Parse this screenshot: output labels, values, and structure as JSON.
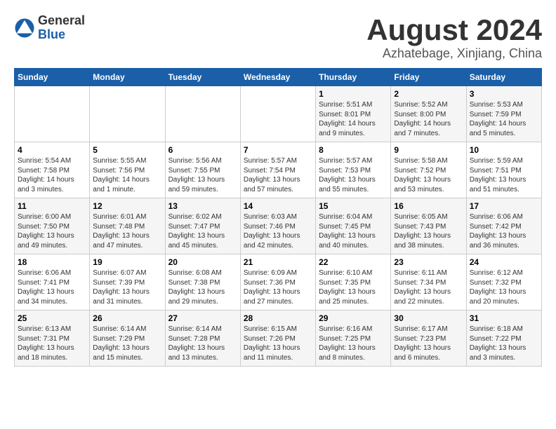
{
  "header": {
    "logo_general": "General",
    "logo_blue": "Blue",
    "month_year": "August 2024",
    "location": "Azhatebage, Xinjiang, China"
  },
  "weekdays": [
    "Sunday",
    "Monday",
    "Tuesday",
    "Wednesday",
    "Thursday",
    "Friday",
    "Saturday"
  ],
  "weeks": [
    [
      {
        "day": "",
        "info": ""
      },
      {
        "day": "",
        "info": ""
      },
      {
        "day": "",
        "info": ""
      },
      {
        "day": "",
        "info": ""
      },
      {
        "day": "1",
        "info": "Sunrise: 5:51 AM\nSunset: 8:01 PM\nDaylight: 14 hours\nand 9 minutes."
      },
      {
        "day": "2",
        "info": "Sunrise: 5:52 AM\nSunset: 8:00 PM\nDaylight: 14 hours\nand 7 minutes."
      },
      {
        "day": "3",
        "info": "Sunrise: 5:53 AM\nSunset: 7:59 PM\nDaylight: 14 hours\nand 5 minutes."
      }
    ],
    [
      {
        "day": "4",
        "info": "Sunrise: 5:54 AM\nSunset: 7:58 PM\nDaylight: 14 hours\nand 3 minutes."
      },
      {
        "day": "5",
        "info": "Sunrise: 5:55 AM\nSunset: 7:56 PM\nDaylight: 14 hours\nand 1 minute."
      },
      {
        "day": "6",
        "info": "Sunrise: 5:56 AM\nSunset: 7:55 PM\nDaylight: 13 hours\nand 59 minutes."
      },
      {
        "day": "7",
        "info": "Sunrise: 5:57 AM\nSunset: 7:54 PM\nDaylight: 13 hours\nand 57 minutes."
      },
      {
        "day": "8",
        "info": "Sunrise: 5:57 AM\nSunset: 7:53 PM\nDaylight: 13 hours\nand 55 minutes."
      },
      {
        "day": "9",
        "info": "Sunrise: 5:58 AM\nSunset: 7:52 PM\nDaylight: 13 hours\nand 53 minutes."
      },
      {
        "day": "10",
        "info": "Sunrise: 5:59 AM\nSunset: 7:51 PM\nDaylight: 13 hours\nand 51 minutes."
      }
    ],
    [
      {
        "day": "11",
        "info": "Sunrise: 6:00 AM\nSunset: 7:50 PM\nDaylight: 13 hours\nand 49 minutes."
      },
      {
        "day": "12",
        "info": "Sunrise: 6:01 AM\nSunset: 7:48 PM\nDaylight: 13 hours\nand 47 minutes."
      },
      {
        "day": "13",
        "info": "Sunrise: 6:02 AM\nSunset: 7:47 PM\nDaylight: 13 hours\nand 45 minutes."
      },
      {
        "day": "14",
        "info": "Sunrise: 6:03 AM\nSunset: 7:46 PM\nDaylight: 13 hours\nand 42 minutes."
      },
      {
        "day": "15",
        "info": "Sunrise: 6:04 AM\nSunset: 7:45 PM\nDaylight: 13 hours\nand 40 minutes."
      },
      {
        "day": "16",
        "info": "Sunrise: 6:05 AM\nSunset: 7:43 PM\nDaylight: 13 hours\nand 38 minutes."
      },
      {
        "day": "17",
        "info": "Sunrise: 6:06 AM\nSunset: 7:42 PM\nDaylight: 13 hours\nand 36 minutes."
      }
    ],
    [
      {
        "day": "18",
        "info": "Sunrise: 6:06 AM\nSunset: 7:41 PM\nDaylight: 13 hours\nand 34 minutes."
      },
      {
        "day": "19",
        "info": "Sunrise: 6:07 AM\nSunset: 7:39 PM\nDaylight: 13 hours\nand 31 minutes."
      },
      {
        "day": "20",
        "info": "Sunrise: 6:08 AM\nSunset: 7:38 PM\nDaylight: 13 hours\nand 29 minutes."
      },
      {
        "day": "21",
        "info": "Sunrise: 6:09 AM\nSunset: 7:36 PM\nDaylight: 13 hours\nand 27 minutes."
      },
      {
        "day": "22",
        "info": "Sunrise: 6:10 AM\nSunset: 7:35 PM\nDaylight: 13 hours\nand 25 minutes."
      },
      {
        "day": "23",
        "info": "Sunrise: 6:11 AM\nSunset: 7:34 PM\nDaylight: 13 hours\nand 22 minutes."
      },
      {
        "day": "24",
        "info": "Sunrise: 6:12 AM\nSunset: 7:32 PM\nDaylight: 13 hours\nand 20 minutes."
      }
    ],
    [
      {
        "day": "25",
        "info": "Sunrise: 6:13 AM\nSunset: 7:31 PM\nDaylight: 13 hours\nand 18 minutes."
      },
      {
        "day": "26",
        "info": "Sunrise: 6:14 AM\nSunset: 7:29 PM\nDaylight: 13 hours\nand 15 minutes."
      },
      {
        "day": "27",
        "info": "Sunrise: 6:14 AM\nSunset: 7:28 PM\nDaylight: 13 hours\nand 13 minutes."
      },
      {
        "day": "28",
        "info": "Sunrise: 6:15 AM\nSunset: 7:26 PM\nDaylight: 13 hours\nand 11 minutes."
      },
      {
        "day": "29",
        "info": "Sunrise: 6:16 AM\nSunset: 7:25 PM\nDaylight: 13 hours\nand 8 minutes."
      },
      {
        "day": "30",
        "info": "Sunrise: 6:17 AM\nSunset: 7:23 PM\nDaylight: 13 hours\nand 6 minutes."
      },
      {
        "day": "31",
        "info": "Sunrise: 6:18 AM\nSunset: 7:22 PM\nDaylight: 13 hours\nand 3 minutes."
      }
    ]
  ]
}
